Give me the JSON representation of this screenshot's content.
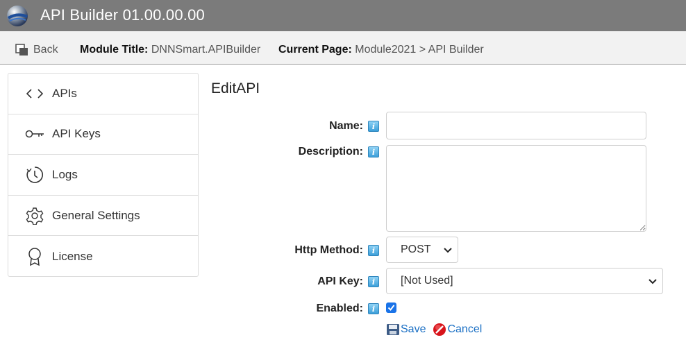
{
  "app": {
    "title": "API Builder 01.00.00.00"
  },
  "infobar": {
    "back_label": "Back",
    "module_title_label": "Module Title:",
    "module_title_value": "DNNSmart.APIBuilder",
    "current_page_label": "Current Page:",
    "current_page_value": "Module2021 > API Builder"
  },
  "sidebar": {
    "items": [
      {
        "label": "APIs",
        "icon": "code-icon"
      },
      {
        "label": "API Keys",
        "icon": "key-icon"
      },
      {
        "label": "Logs",
        "icon": "clock-icon"
      },
      {
        "label": "General Settings",
        "icon": "gear-icon"
      },
      {
        "label": "License",
        "icon": "award-icon"
      }
    ]
  },
  "form": {
    "title": "EditAPI",
    "help_glyph": "i",
    "name": {
      "label": "Name:",
      "value": "",
      "placeholder": ""
    },
    "description": {
      "label": "Description:",
      "value": ""
    },
    "http_method": {
      "label": "Http Method:",
      "value": "POST"
    },
    "api_key": {
      "label": "API Key:",
      "value": "[Not Used]"
    },
    "enabled": {
      "label": "Enabled:",
      "checked": true
    },
    "save_label": "Save",
    "cancel_label": "Cancel"
  },
  "colors": {
    "titlebar": "#7b7b7b",
    "infobar": "#f2f2f2",
    "link": "#1a6fc4",
    "checkbox": "#1a73e8",
    "help_icon": "#3c9fd9"
  }
}
